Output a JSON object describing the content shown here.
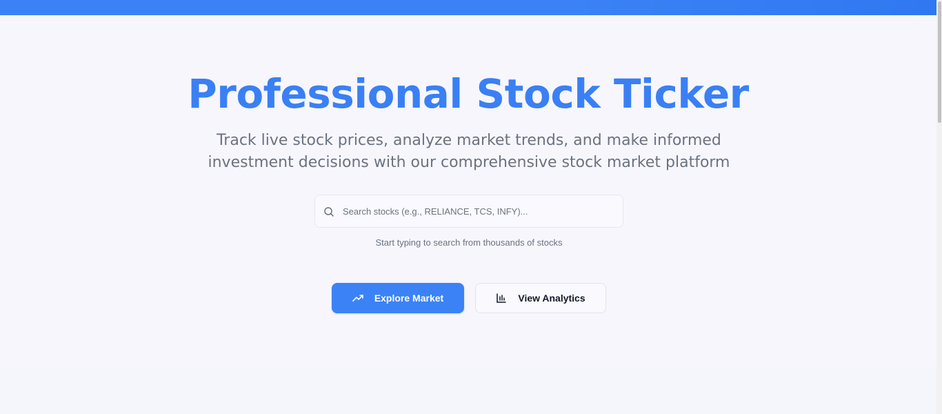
{
  "hero": {
    "title": "Professional Stock Ticker",
    "subtitle_line1": "Track live stock prices, analyze market trends, and make informed",
    "subtitle_line2": "investment decisions with our comprehensive stock market platform"
  },
  "search": {
    "placeholder": "Search stocks (e.g., RELIANCE, TCS, INFY)...",
    "value": "",
    "hint": "Start typing to search from thousands of stocks",
    "icon": "search-icon"
  },
  "actions": {
    "explore_label": "Explore Market",
    "explore_icon": "trending-up-icon",
    "analytics_label": "View Analytics",
    "analytics_icon": "bar-chart-icon"
  },
  "colors": {
    "accent": "#3b82f6",
    "title": "#3a80f4",
    "muted_text": "#6b7280",
    "background": "#f7f6fd"
  }
}
